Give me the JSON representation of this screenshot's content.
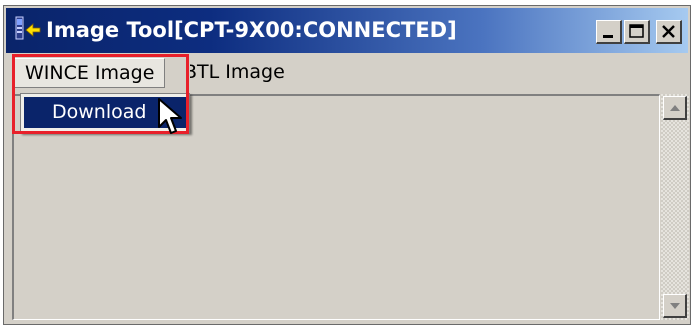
{
  "window": {
    "title": "Image Tool[CPT-9X00:CONNECTED]",
    "app_icon": "device-arrow-icon",
    "caption_buttons": {
      "minimize": "minimize-icon",
      "maximize": "maximize-icon",
      "close": "close-icon"
    }
  },
  "menubar": {
    "items": [
      {
        "label": "WINCE Image",
        "state": "open"
      },
      {
        "label": "BTL Image",
        "state": "normal"
      }
    ]
  },
  "dropdown": {
    "items": [
      {
        "label": "Download",
        "state": "hovered"
      }
    ]
  },
  "scrollbar": {
    "up_icon": "arrow-up-icon",
    "down_icon": "arrow-down-icon"
  },
  "colors": {
    "titlebar_start": "#0a246a",
    "titlebar_end": "#a6caf0",
    "menu_highlight": "#0a246a",
    "annotation_red": "#e8202a",
    "window_face": "#d4d0c8"
  }
}
